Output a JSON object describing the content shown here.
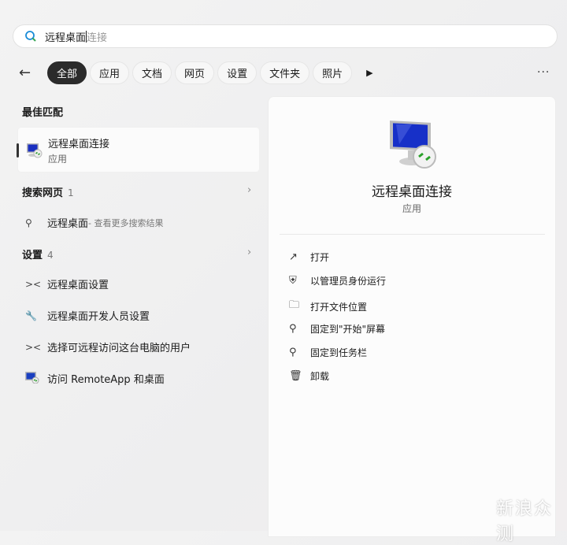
{
  "search": {
    "typed": "远程桌面",
    "suggestion": "连接"
  },
  "filters": [
    "全部",
    "应用",
    "文档",
    "网页",
    "设置",
    "文件夹",
    "照片"
  ],
  "left": {
    "best_match_header": "最佳匹配",
    "best_match": {
      "title": "远程桌面连接",
      "subtitle": "应用"
    },
    "web_header": "搜索网页",
    "web_count": "1",
    "web_item": {
      "query": "远程桌面",
      "hint": " - 查看更多搜索结果"
    },
    "settings_header": "设置",
    "settings_count": "4",
    "settings_items": [
      "远程桌面设置",
      "远程桌面开发人员设置",
      "选择可远程访问这台电脑的用户",
      "访问 RemoteApp 和桌面"
    ]
  },
  "right": {
    "title": "远程桌面连接",
    "subtitle": "应用",
    "actions": [
      "打开",
      "以管理员身份运行",
      "打开文件位置",
      "固定到\"开始\"屏幕",
      "固定到任务栏",
      "卸载"
    ]
  },
  "watermark": "新浪众测"
}
